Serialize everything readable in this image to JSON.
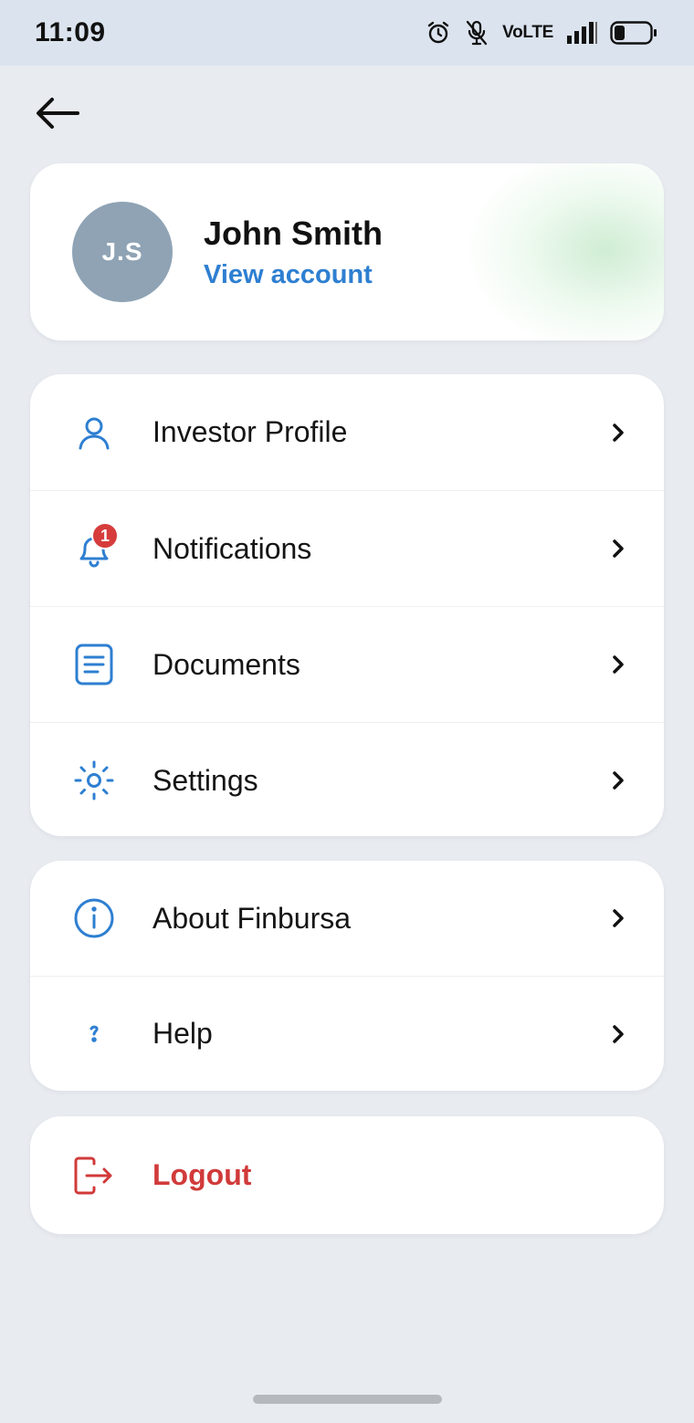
{
  "status_bar": {
    "time": "11:09",
    "network_label": "VoLTE",
    "icons": [
      "alarm-icon",
      "mute-icon",
      "signal-icon",
      "battery-icon"
    ]
  },
  "header": {
    "back_icon": "arrow-left-icon"
  },
  "profile": {
    "initials": "J.S",
    "name": "John Smith",
    "view_account_label": "View account"
  },
  "menu_groups": [
    {
      "items": [
        {
          "label": "Investor Profile",
          "icon": "user-icon"
        },
        {
          "label": "Notifications",
          "icon": "bell-icon",
          "badge": "1"
        },
        {
          "label": "Documents",
          "icon": "document-icon"
        },
        {
          "label": "Settings",
          "icon": "sun-settings-icon"
        }
      ]
    },
    {
      "items": [
        {
          "label": "About Finbursa",
          "icon": "info-icon"
        },
        {
          "label": "Help",
          "icon": "help-icon"
        }
      ]
    }
  ],
  "logout": {
    "label": "Logout",
    "icon": "logout-icon"
  },
  "colors": {
    "background": "#e8ebf0",
    "status_bar": "#dbe3ee",
    "accent_blue": "#2e7fd1",
    "logout_red": "#d13a3a",
    "badge_red": "#d63c3c",
    "avatar_gray": "#8fa3b5"
  }
}
